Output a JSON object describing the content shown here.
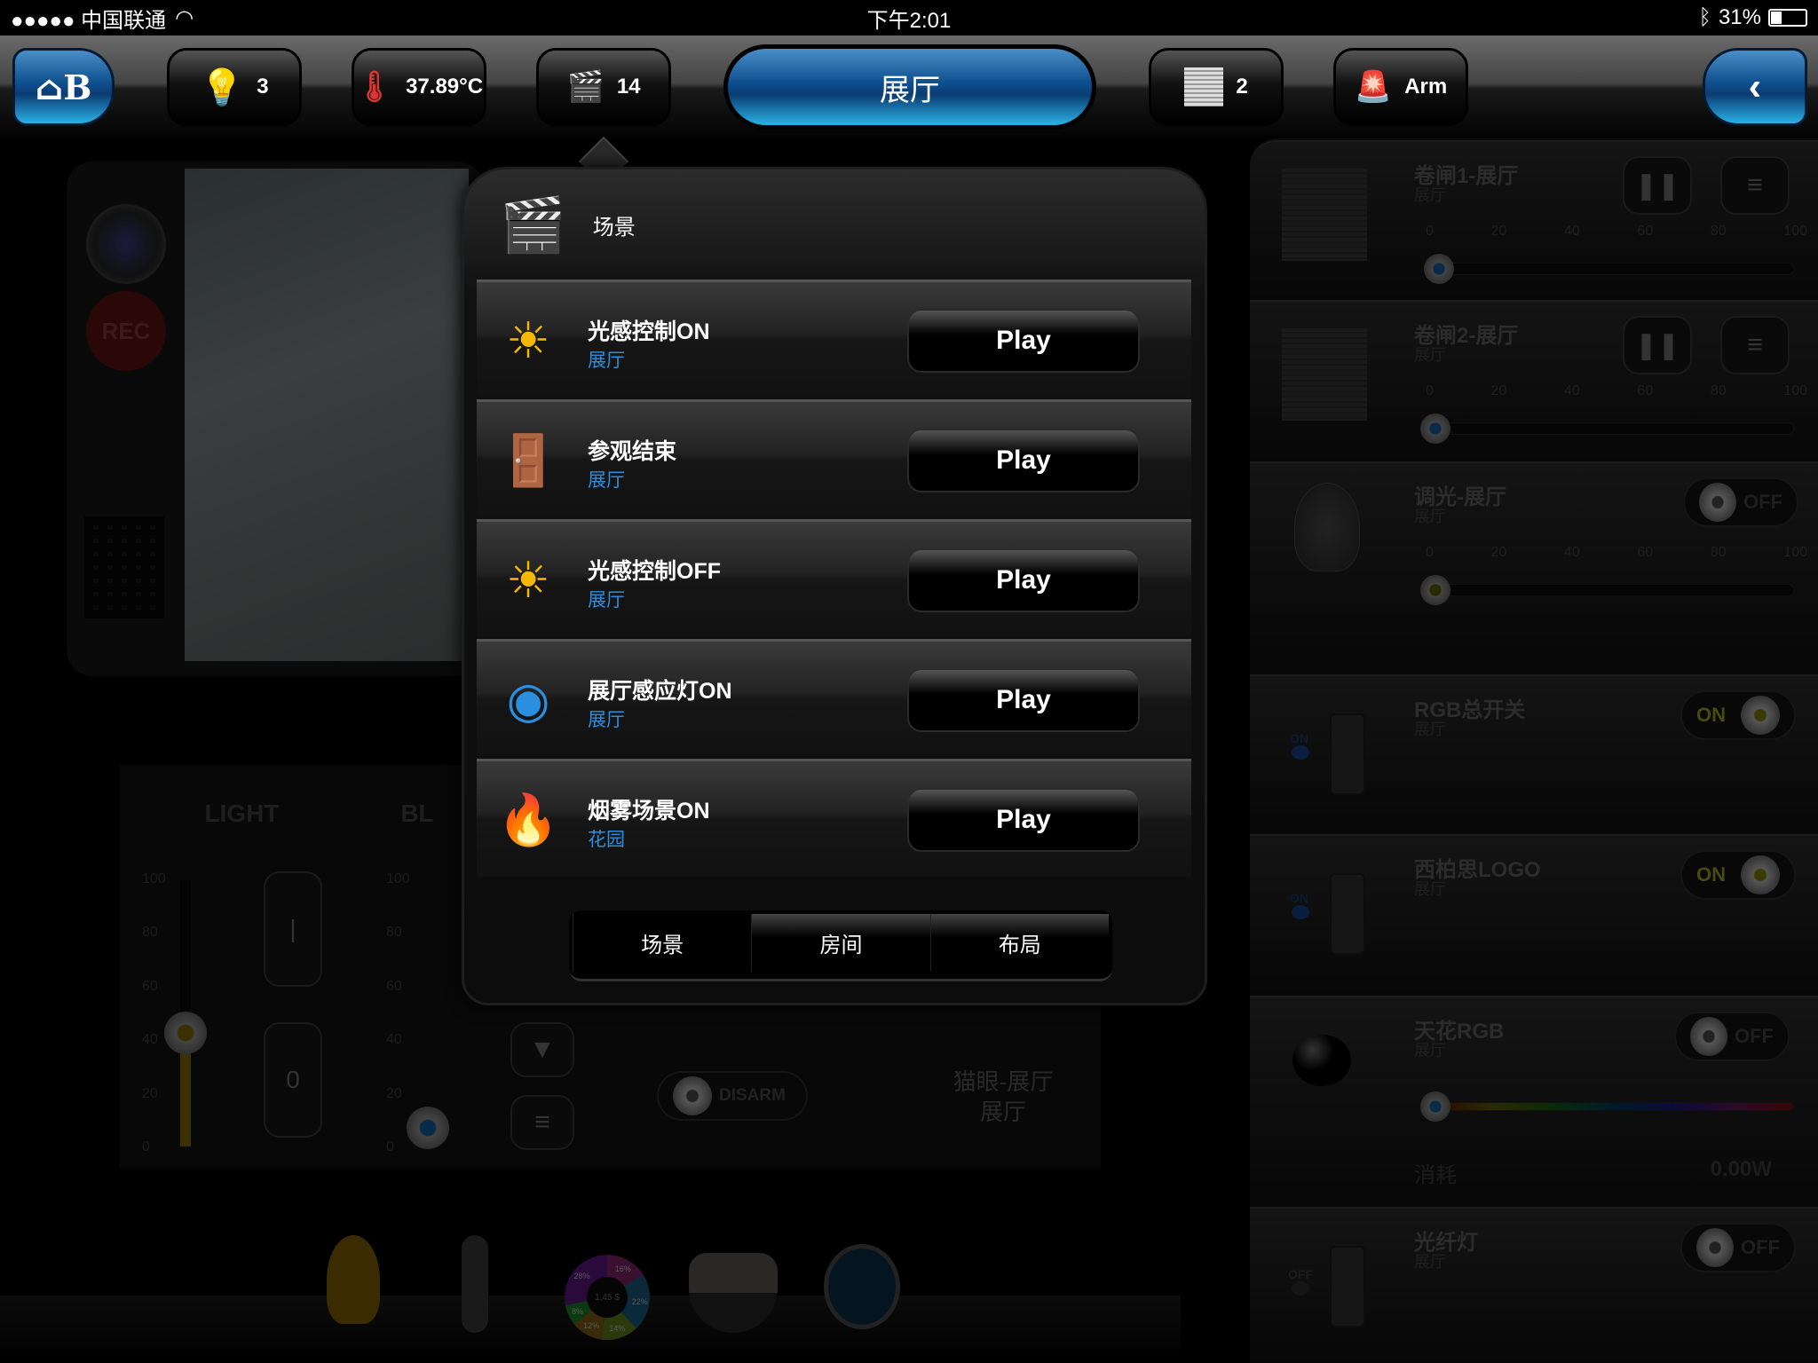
{
  "status": {
    "carrier": "●●●●● 中国联通",
    "wifi_icon": "wifi-icon",
    "time": "下午2:01",
    "bluetooth_icon": "bluetooth-icon",
    "battery": "31%",
    "battery_level": 0.31
  },
  "topbar": {
    "home_icon": "home-logo",
    "lights": "3",
    "temperature": "37.89°C",
    "scenes": "14",
    "room": "展厅",
    "shutters": "2",
    "security": "Arm",
    "back_icon": "chevron-left-icon"
  },
  "camera": {
    "rec": "REC"
  },
  "light_panel": {
    "col1": "LIGHT",
    "col2": "BL",
    "scale": [
      "100",
      "80",
      "60",
      "40",
      "20",
      "0"
    ],
    "on_label": "|",
    "off_label": "0",
    "value1": 40,
    "value2": 0,
    "disarm": "DISARM",
    "cat_eye": "猫眼-展厅",
    "cat_eye_room": "展厅"
  },
  "dock": {
    "energy_total": "1,45 $",
    "slices": [
      "16%",
      "22%",
      "14%",
      "12%",
      "8%",
      "28%"
    ]
  },
  "right": {
    "scale": [
      "0",
      "20",
      "40",
      "60",
      "80",
      "100"
    ],
    "items": [
      {
        "title": "卷闸1-展厅",
        "room": "展厅",
        "value": 0
      },
      {
        "title": "卷闸2-展厅",
        "room": "展厅",
        "value": 0
      },
      {
        "title": "调光-展厅",
        "room": "展厅",
        "state": "OFF",
        "value": 0
      },
      {
        "title": "RGB总开关",
        "room": "展厅",
        "state": "ON",
        "led": "ON"
      },
      {
        "title": "西柏思LOGO",
        "room": "展厅",
        "state": "ON",
        "led": "ON"
      },
      {
        "title": "天花RGB",
        "room": "展厅",
        "state": "OFF",
        "consumption_label": "消耗",
        "consumption": "0.00W"
      },
      {
        "title": "光纤灯",
        "room": "展厅",
        "state": "OFF",
        "led": "OFF"
      }
    ]
  },
  "popup": {
    "title": "场景",
    "scenes": [
      {
        "name": "光感控制ON",
        "room": "展厅",
        "icon": "light-sensor-icon",
        "action": "Play"
      },
      {
        "name": "参观结束",
        "room": "展厅",
        "icon": "door-exit-icon",
        "action": "Play"
      },
      {
        "name": "光感控制OFF",
        "room": "展厅",
        "icon": "light-sensor-icon",
        "action": "Play"
      },
      {
        "name": "展厅感应灯ON",
        "room": "展厅",
        "icon": "eye-sensor-icon",
        "action": "Play"
      },
      {
        "name": "烟雾场景ON",
        "room": "花园",
        "icon": "smoke-detector-icon",
        "action": "Play"
      }
    ],
    "tabs": [
      {
        "label": "场景",
        "selected": true
      },
      {
        "label": "房间",
        "selected": false
      },
      {
        "label": "布局",
        "selected": false
      }
    ]
  },
  "colors": {
    "accent_blue": "#1e7fd0",
    "room_link": "#2a8fe0",
    "on_yellow": "#4a4a10"
  }
}
